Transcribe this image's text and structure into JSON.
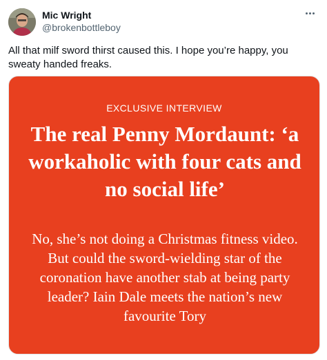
{
  "author": {
    "display_name": "Mic Wright",
    "handle": "@brokenbottleboy"
  },
  "more_icon": "more-horizontal-icon",
  "tweet": {
    "text": "All that milf sword thirst caused this. I hope you’re happy, you sweaty handed freaks."
  },
  "media": {
    "kicker": "EXCLUSIVE INTERVIEW",
    "headline": "The real Penny Mordaunt: ‘a workaholic with four cats and no social life’",
    "standfirst": "No, she’s not doing a Christmas fitness video. But could the sword-wielding star of the coronation have another stab at being party leader? Iain Dale meets the nation’s new favourite Tory",
    "background_color": "#e8401f"
  }
}
